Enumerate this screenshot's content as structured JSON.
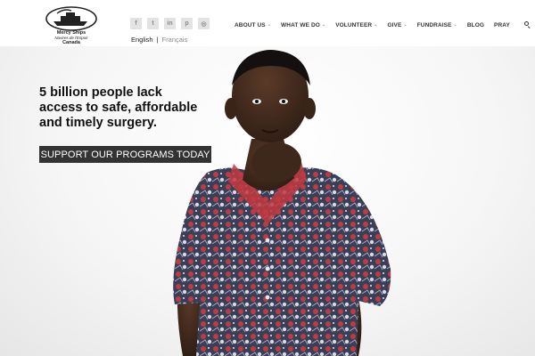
{
  "brand": {
    "name": "Mercy Ships",
    "name_fr": "Navires de l'Espoir",
    "country": "Canada"
  },
  "social": [
    {
      "icon": "facebook-icon",
      "glyph": "f"
    },
    {
      "icon": "twitter-icon",
      "glyph": "t"
    },
    {
      "icon": "linkedin-icon",
      "glyph": "in"
    },
    {
      "icon": "pinterest-icon",
      "glyph": "p"
    },
    {
      "icon": "instagram-icon",
      "glyph": "◎"
    }
  ],
  "language": {
    "current": "English",
    "separator": "|",
    "alternate": "Français"
  },
  "nav": {
    "items": [
      {
        "label": "ABOUT US",
        "dropdown": true
      },
      {
        "label": "WHAT WE DO",
        "dropdown": true
      },
      {
        "label": "VOLUNTEER",
        "dropdown": true
      },
      {
        "label": "GIVE",
        "dropdown": true
      },
      {
        "label": "FUNDRAISE",
        "dropdown": true
      },
      {
        "label": "BLOG",
        "dropdown": false
      },
      {
        "label": "PRAY",
        "dropdown": false
      }
    ],
    "search_icon": "search-icon",
    "chevron": "⌄"
  },
  "hero": {
    "headline": "5 billion people lack access to safe, affordable and timely surgery.",
    "cta_label": "SUPPORT OUR PROGRAMS TODAY"
  },
  "colors": {
    "cta_background": "#333333",
    "cta_text": "#ffffff",
    "nav_text": "#333333",
    "social_bg": "#e3e3e3"
  }
}
